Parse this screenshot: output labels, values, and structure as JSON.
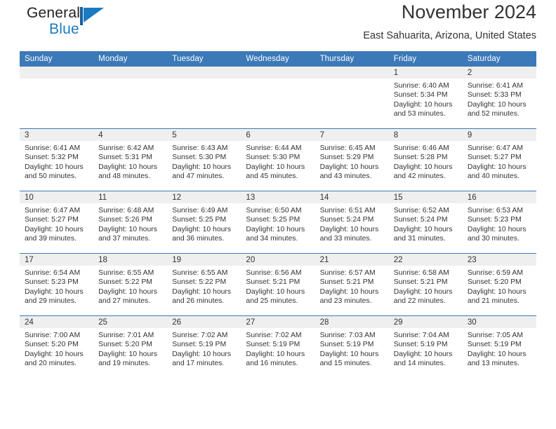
{
  "brand": {
    "name_part1": "General",
    "name_part2": "Blue",
    "mark": "flag-triangle-icon",
    "accent_color": "#1b7ac2"
  },
  "header": {
    "title": "November 2024",
    "subtitle": "East Sahuarita, Arizona, United States"
  },
  "colors": {
    "header_blue": "#3b79b8",
    "daynum_strip": "#efefef",
    "text": "#333333"
  },
  "weekday_headers": [
    "Sunday",
    "Monday",
    "Tuesday",
    "Wednesday",
    "Thursday",
    "Friday",
    "Saturday"
  ],
  "labels": {
    "sunrise_prefix": "Sunrise:",
    "sunset_prefix": "Sunset:",
    "daylight_prefix": "Daylight:"
  },
  "weeks": [
    [
      {
        "day": "",
        "empty": true,
        "l1": "",
        "l2": "",
        "l3": "",
        "l4": ""
      },
      {
        "day": "",
        "empty": true,
        "l1": "",
        "l2": "",
        "l3": "",
        "l4": ""
      },
      {
        "day": "",
        "empty": true,
        "l1": "",
        "l2": "",
        "l3": "",
        "l4": ""
      },
      {
        "day": "",
        "empty": true,
        "l1": "",
        "l2": "",
        "l3": "",
        "l4": ""
      },
      {
        "day": "",
        "empty": true,
        "l1": "",
        "l2": "",
        "l3": "",
        "l4": ""
      },
      {
        "day": "1",
        "empty": false,
        "l1": "Sunrise: 6:40 AM",
        "l2": "Sunset: 5:34 PM",
        "l3": "Daylight: 10 hours",
        "l4": "and 53 minutes."
      },
      {
        "day": "2",
        "empty": false,
        "l1": "Sunrise: 6:41 AM",
        "l2": "Sunset: 5:33 PM",
        "l3": "Daylight: 10 hours",
        "l4": "and 52 minutes."
      }
    ],
    [
      {
        "day": "3",
        "empty": false,
        "l1": "Sunrise: 6:41 AM",
        "l2": "Sunset: 5:32 PM",
        "l3": "Daylight: 10 hours",
        "l4": "and 50 minutes."
      },
      {
        "day": "4",
        "empty": false,
        "l1": "Sunrise: 6:42 AM",
        "l2": "Sunset: 5:31 PM",
        "l3": "Daylight: 10 hours",
        "l4": "and 48 minutes."
      },
      {
        "day": "5",
        "empty": false,
        "l1": "Sunrise: 6:43 AM",
        "l2": "Sunset: 5:30 PM",
        "l3": "Daylight: 10 hours",
        "l4": "and 47 minutes."
      },
      {
        "day": "6",
        "empty": false,
        "l1": "Sunrise: 6:44 AM",
        "l2": "Sunset: 5:30 PM",
        "l3": "Daylight: 10 hours",
        "l4": "and 45 minutes."
      },
      {
        "day": "7",
        "empty": false,
        "l1": "Sunrise: 6:45 AM",
        "l2": "Sunset: 5:29 PM",
        "l3": "Daylight: 10 hours",
        "l4": "and 43 minutes."
      },
      {
        "day": "8",
        "empty": false,
        "l1": "Sunrise: 6:46 AM",
        "l2": "Sunset: 5:28 PM",
        "l3": "Daylight: 10 hours",
        "l4": "and 42 minutes."
      },
      {
        "day": "9",
        "empty": false,
        "l1": "Sunrise: 6:47 AM",
        "l2": "Sunset: 5:27 PM",
        "l3": "Daylight: 10 hours",
        "l4": "and 40 minutes."
      }
    ],
    [
      {
        "day": "10",
        "empty": false,
        "l1": "Sunrise: 6:47 AM",
        "l2": "Sunset: 5:27 PM",
        "l3": "Daylight: 10 hours",
        "l4": "and 39 minutes."
      },
      {
        "day": "11",
        "empty": false,
        "l1": "Sunrise: 6:48 AM",
        "l2": "Sunset: 5:26 PM",
        "l3": "Daylight: 10 hours",
        "l4": "and 37 minutes."
      },
      {
        "day": "12",
        "empty": false,
        "l1": "Sunrise: 6:49 AM",
        "l2": "Sunset: 5:25 PM",
        "l3": "Daylight: 10 hours",
        "l4": "and 36 minutes."
      },
      {
        "day": "13",
        "empty": false,
        "l1": "Sunrise: 6:50 AM",
        "l2": "Sunset: 5:25 PM",
        "l3": "Daylight: 10 hours",
        "l4": "and 34 minutes."
      },
      {
        "day": "14",
        "empty": false,
        "l1": "Sunrise: 6:51 AM",
        "l2": "Sunset: 5:24 PM",
        "l3": "Daylight: 10 hours",
        "l4": "and 33 minutes."
      },
      {
        "day": "15",
        "empty": false,
        "l1": "Sunrise: 6:52 AM",
        "l2": "Sunset: 5:24 PM",
        "l3": "Daylight: 10 hours",
        "l4": "and 31 minutes."
      },
      {
        "day": "16",
        "empty": false,
        "l1": "Sunrise: 6:53 AM",
        "l2": "Sunset: 5:23 PM",
        "l3": "Daylight: 10 hours",
        "l4": "and 30 minutes."
      }
    ],
    [
      {
        "day": "17",
        "empty": false,
        "l1": "Sunrise: 6:54 AM",
        "l2": "Sunset: 5:23 PM",
        "l3": "Daylight: 10 hours",
        "l4": "and 29 minutes."
      },
      {
        "day": "18",
        "empty": false,
        "l1": "Sunrise: 6:55 AM",
        "l2": "Sunset: 5:22 PM",
        "l3": "Daylight: 10 hours",
        "l4": "and 27 minutes."
      },
      {
        "day": "19",
        "empty": false,
        "l1": "Sunrise: 6:55 AM",
        "l2": "Sunset: 5:22 PM",
        "l3": "Daylight: 10 hours",
        "l4": "and 26 minutes."
      },
      {
        "day": "20",
        "empty": false,
        "l1": "Sunrise: 6:56 AM",
        "l2": "Sunset: 5:21 PM",
        "l3": "Daylight: 10 hours",
        "l4": "and 25 minutes."
      },
      {
        "day": "21",
        "empty": false,
        "l1": "Sunrise: 6:57 AM",
        "l2": "Sunset: 5:21 PM",
        "l3": "Daylight: 10 hours",
        "l4": "and 23 minutes."
      },
      {
        "day": "22",
        "empty": false,
        "l1": "Sunrise: 6:58 AM",
        "l2": "Sunset: 5:21 PM",
        "l3": "Daylight: 10 hours",
        "l4": "and 22 minutes."
      },
      {
        "day": "23",
        "empty": false,
        "l1": "Sunrise: 6:59 AM",
        "l2": "Sunset: 5:20 PM",
        "l3": "Daylight: 10 hours",
        "l4": "and 21 minutes."
      }
    ],
    [
      {
        "day": "24",
        "empty": false,
        "l1": "Sunrise: 7:00 AM",
        "l2": "Sunset: 5:20 PM",
        "l3": "Daylight: 10 hours",
        "l4": "and 20 minutes."
      },
      {
        "day": "25",
        "empty": false,
        "l1": "Sunrise: 7:01 AM",
        "l2": "Sunset: 5:20 PM",
        "l3": "Daylight: 10 hours",
        "l4": "and 19 minutes."
      },
      {
        "day": "26",
        "empty": false,
        "l1": "Sunrise: 7:02 AM",
        "l2": "Sunset: 5:19 PM",
        "l3": "Daylight: 10 hours",
        "l4": "and 17 minutes."
      },
      {
        "day": "27",
        "empty": false,
        "l1": "Sunrise: 7:02 AM",
        "l2": "Sunset: 5:19 PM",
        "l3": "Daylight: 10 hours",
        "l4": "and 16 minutes."
      },
      {
        "day": "28",
        "empty": false,
        "l1": "Sunrise: 7:03 AM",
        "l2": "Sunset: 5:19 PM",
        "l3": "Daylight: 10 hours",
        "l4": "and 15 minutes."
      },
      {
        "day": "29",
        "empty": false,
        "l1": "Sunrise: 7:04 AM",
        "l2": "Sunset: 5:19 PM",
        "l3": "Daylight: 10 hours",
        "l4": "and 14 minutes."
      },
      {
        "day": "30",
        "empty": false,
        "l1": "Sunrise: 7:05 AM",
        "l2": "Sunset: 5:19 PM",
        "l3": "Daylight: 10 hours",
        "l4": "and 13 minutes."
      }
    ]
  ]
}
